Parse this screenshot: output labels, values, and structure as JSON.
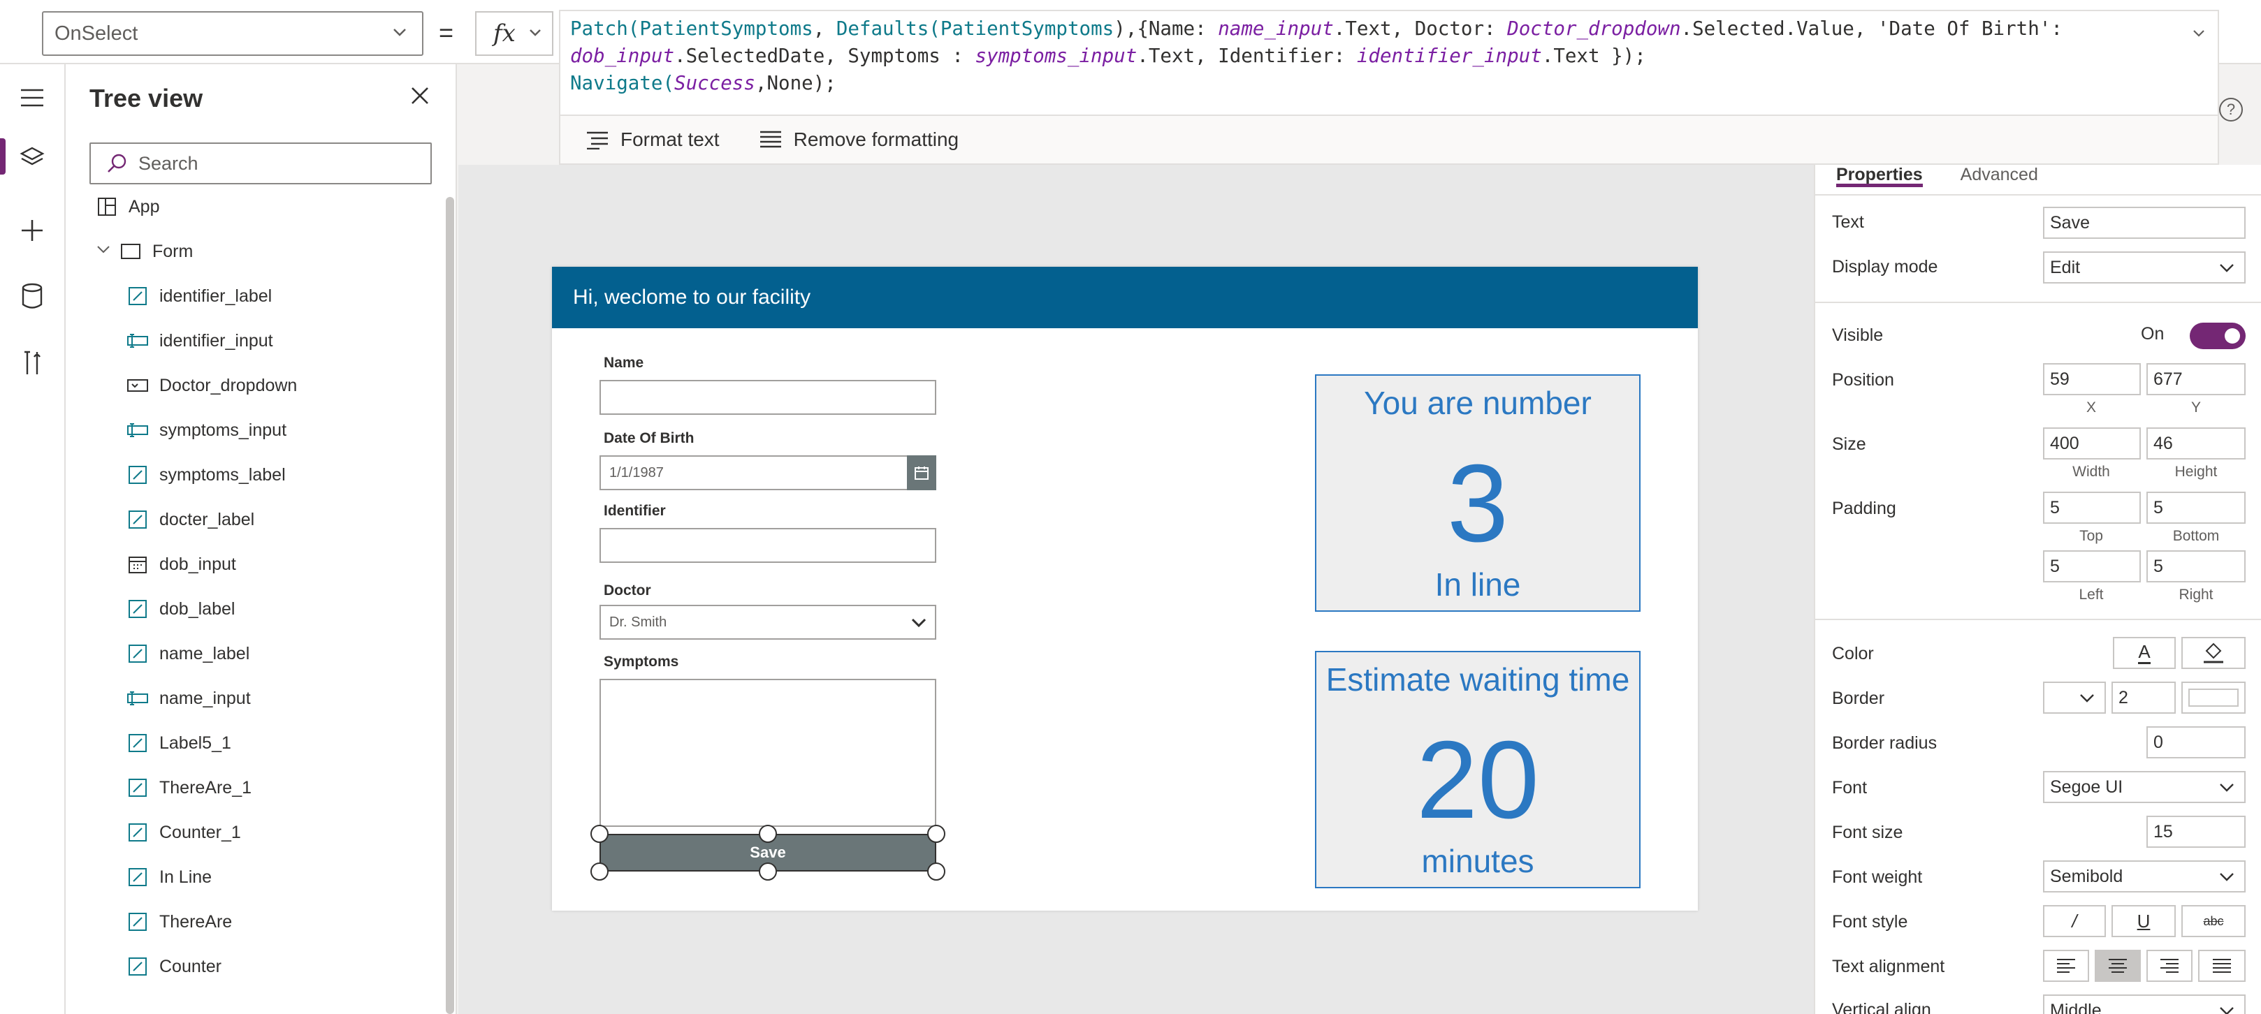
{
  "formula_bar": {
    "property": "OnSelect",
    "equals": "=",
    "fx": "fx",
    "line1_a": "Patch(",
    "line1_b": "PatientSymptoms",
    "line1_c": ", ",
    "line1_d": "Defaults",
    "line1_e": "(",
    "line1_f": "PatientSymptoms",
    "line1_g": "),{Name: ",
    "line1_h": "name_input",
    "line1_i": ".Text, Doctor: ",
    "line1_j": "Doctor_dropdown",
    "line1_k": ".Selected.Value, 'Date Of Birth':",
    "line2_a": "dob_input",
    "line2_b": ".SelectedDate, Symptoms : ",
    "line2_c": "symptoms_input",
    "line2_d": ".Text, Identifier: ",
    "line2_e": "identifier_input",
    "line2_f": ".Text });",
    "line3_a": "Navigate",
    "line3_b": "(",
    "line3_c": "Success",
    "line3_d": ",None);",
    "format_text": "Format text",
    "remove_formatting": "Remove formatting",
    "help": "?"
  },
  "tree": {
    "title": "Tree view",
    "search_placeholder": "Search",
    "items": [
      {
        "label": "App",
        "icon": "app-icon"
      },
      {
        "label": "Form",
        "icon": "screen-icon"
      },
      {
        "label": "identifier_label",
        "icon": "label-icon"
      },
      {
        "label": "identifier_input",
        "icon": "textinput-icon"
      },
      {
        "label": "Doctor_dropdown",
        "icon": "dropdown-icon"
      },
      {
        "label": "symptoms_input",
        "icon": "textinput-icon"
      },
      {
        "label": "symptoms_label",
        "icon": "label-icon"
      },
      {
        "label": "docter_label",
        "icon": "label-icon"
      },
      {
        "label": "dob_input",
        "icon": "datepicker-icon"
      },
      {
        "label": "dob_label",
        "icon": "label-icon"
      },
      {
        "label": "name_label",
        "icon": "label-icon"
      },
      {
        "label": "name_input",
        "icon": "textinput-icon"
      },
      {
        "label": "Label5_1",
        "icon": "label-icon"
      },
      {
        "label": "ThereAre_1",
        "icon": "label-icon"
      },
      {
        "label": "Counter_1",
        "icon": "label-icon"
      },
      {
        "label": "In Line",
        "icon": "label-icon"
      },
      {
        "label": "ThereAre",
        "icon": "label-icon"
      },
      {
        "label": "Counter",
        "icon": "label-icon"
      }
    ]
  },
  "screen": {
    "header": "Hi, weclome to our facility",
    "name_label": "Name",
    "dob_label": "Date Of Birth",
    "dob_value": "1/1/1987",
    "identifier_label": "Identifier",
    "doctor_label": "Doctor",
    "doctor_value": "Dr. Smith",
    "symptoms_label": "Symptoms",
    "save_label": "Save",
    "card1_top": "You are number",
    "card1_number": "3",
    "card1_bottom": "In line",
    "card2_top": "Estimate waiting time",
    "card2_number": "20",
    "card2_bottom": "minutes"
  },
  "properties": {
    "tab_properties": "Properties",
    "tab_advanced": "Advanced",
    "text_label": "Text",
    "text_value": "Save",
    "display_mode_label": "Display mode",
    "display_mode_value": "Edit",
    "visible_label": "Visible",
    "visible_value": "On",
    "position_label": "Position",
    "position_x": "59",
    "position_y": "677",
    "x_label": "X",
    "y_label": "Y",
    "size_label": "Size",
    "size_width": "400",
    "size_height": "46",
    "width_label": "Width",
    "height_label": "Height",
    "padding_label": "Padding",
    "padding_top": "5",
    "padding_bottom": "5",
    "padding_left": "5",
    "padding_right": "5",
    "top_label": "Top",
    "bottom_label": "Bottom",
    "left_label": "Left",
    "right_label": "Right",
    "color_label": "Color",
    "color_a": "A",
    "border_label": "Border",
    "border_width": "2",
    "border_radius_label": "Border radius",
    "border_radius_value": "0",
    "font_label": "Font",
    "font_value": "Segoe UI",
    "font_size_label": "Font size",
    "font_size_value": "15",
    "font_weight_label": "Font weight",
    "font_weight_value": "Semibold",
    "font_style_label": "Font style",
    "font_style_italic": "/",
    "font_style_underline": "U",
    "font_style_strike": "abc",
    "text_alignment_label": "Text alignment",
    "vertical_align_label": "Vertical align",
    "vertical_align_value": "Middle"
  },
  "colors": {
    "accent": "#742774",
    "header_blue": "#03608f",
    "card_blue": "#2b78c2",
    "button_gray": "#6a7678"
  }
}
